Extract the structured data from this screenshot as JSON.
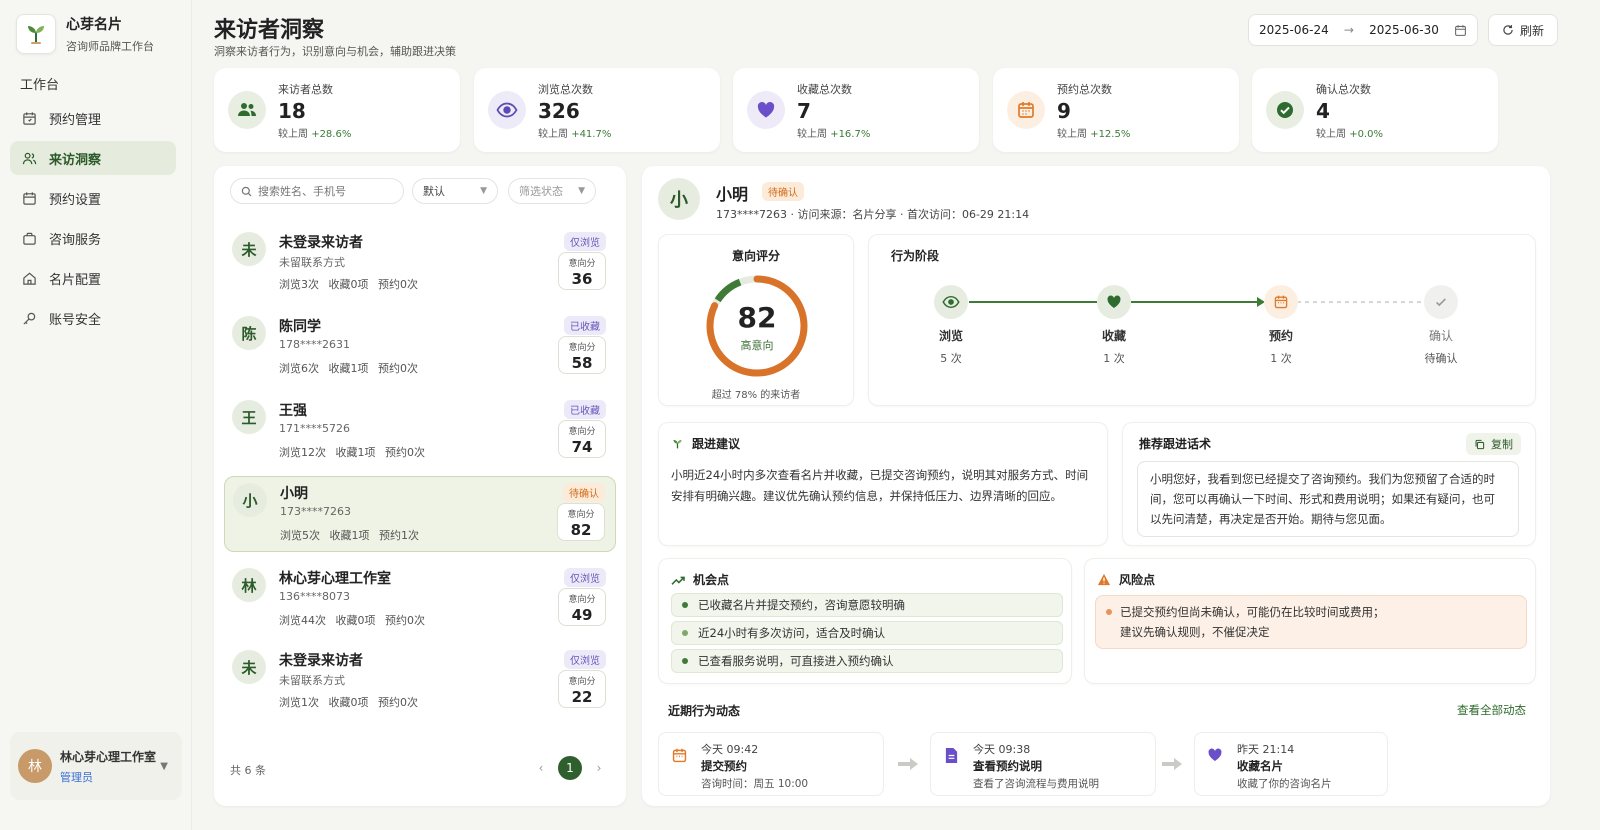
{
  "brand": {
    "name": "心芽名片",
    "subtitle": "咨询师品牌工作台"
  },
  "nav": {
    "section": "工作台",
    "items": [
      {
        "label": "预约管理",
        "icon": "calendar-icon"
      },
      {
        "label": "来访洞察",
        "icon": "users-icon",
        "active": true
      },
      {
        "label": "预约设置",
        "icon": "calendar-settings-icon"
      },
      {
        "label": "咨询服务",
        "icon": "briefcase-icon"
      },
      {
        "label": "名片配置",
        "icon": "home-icon"
      },
      {
        "label": "账号安全",
        "icon": "key-icon"
      }
    ]
  },
  "user": {
    "avatar": "林",
    "name": "林心芽心理工作室",
    "role": "管理员"
  },
  "header": {
    "title": "来访者洞察",
    "subtitle": "洞察来访者行为，识别意向与机会，辅助跟进决策"
  },
  "date_range": {
    "start": "2025-06-24",
    "sep": "→",
    "end": "2025-06-30"
  },
  "refresh_label": "刷新",
  "stats": [
    {
      "label": "来访者总数",
      "value": "18",
      "prefix": "较上周 ",
      "change": "+28.6%",
      "icon": "users-icon",
      "color": "#2f6b2e"
    },
    {
      "label": "浏览总次数",
      "value": "326",
      "prefix": "较上周 ",
      "change": "+41.7%",
      "icon": "eye-icon",
      "color": "#5b4bb5"
    },
    {
      "label": "收藏总次数",
      "value": "7",
      "prefix": "较上周 ",
      "change": "+16.7%",
      "icon": "heart-icon",
      "color": "#6b4fc8"
    },
    {
      "label": "预约总次数",
      "value": "9",
      "prefix": "较上周 ",
      "change": "+12.5%",
      "icon": "calendar-icon",
      "color": "#e07a2a"
    },
    {
      "label": "确认总次数",
      "value": "4",
      "prefix": "较上周 ",
      "change": "+0.0%",
      "icon": "check-circle-icon",
      "color": "#2f6b2e"
    }
  ],
  "filters": {
    "search_placeholder": "搜索姓名、手机号",
    "sort": "默认",
    "status_placeholder": "筛选状态"
  },
  "visitors": [
    {
      "avatar": "未",
      "name": "未登录来访者",
      "phone": "未留联系方式",
      "stats": "浏览3次 收藏0项 预约0次",
      "tag": "仅浏览",
      "tag_type": "blue",
      "score_label": "意向分",
      "score": "36"
    },
    {
      "avatar": "陈",
      "name": "陈同学",
      "phone": "178****2631",
      "stats": "浏览6次 收藏1项 预约0次",
      "tag": "已收藏",
      "tag_type": "blue",
      "score_label": "意向分",
      "score": "58"
    },
    {
      "avatar": "王",
      "name": "王强",
      "phone": "171****5726",
      "stats": "浏览12次 收藏1项 预约0次",
      "tag": "已收藏",
      "tag_type": "blue",
      "score_label": "意向分",
      "score": "74"
    },
    {
      "avatar": "小",
      "name": "小明",
      "phone": "173****7263",
      "stats": "浏览5次 收藏1项 预约1次",
      "tag": "待确认",
      "tag_type": "orange",
      "score_label": "意向分",
      "score": "82",
      "selected": true
    },
    {
      "avatar": "林",
      "name": "林心芽心理工作室",
      "phone": "136****8073",
      "stats": "浏览44次 收藏0项 预约0次",
      "tag": "仅浏览",
      "tag_type": "blue",
      "score_label": "意向分",
      "score": "49"
    },
    {
      "avatar": "未",
      "name": "未登录来访者",
      "phone": "未留联系方式",
      "stats": "浏览1次 收藏0项 预约0次",
      "tag": "仅浏览",
      "tag_type": "blue",
      "score_label": "意向分",
      "score": "22"
    }
  ],
  "list_footer": {
    "count": "共 6 条",
    "page": "1"
  },
  "detail": {
    "avatar": "小",
    "name": "小明",
    "tag": "待确认",
    "info": "173****7263 · 访问来源：名片分享 · 首次访问：06-29 21:14",
    "score": {
      "title": "意向评分",
      "value": 82,
      "level": "高意向",
      "footnote": "超过 78% 的来访者",
      "color": "#d9732a",
      "track": "#3f7a36"
    },
    "stage_title": "行为阶段",
    "stages": [
      {
        "name": "浏览",
        "count": "5 次",
        "icon": "eye-icon"
      },
      {
        "name": "收藏",
        "count": "1 次",
        "icon": "heart-icon"
      },
      {
        "name": "预约",
        "count": "1 次",
        "icon": "calendar-icon"
      },
      {
        "name": "确认",
        "count": "待确认",
        "icon": "check-icon"
      }
    ],
    "suggestion": {
      "title": "跟进建议",
      "text": "小明近24小时内多次查看名片并收藏，已提交咨询预约，说明其对服务方式、时间安排有明确兴趣。建议优先确认预约信息，并保持低压力、边界清晰的回应。"
    },
    "script": {
      "title": "推荐跟进话术",
      "copy": "复制",
      "text": "小明您好，我看到您已经提交了咨询预约。我们为您预留了合适的时间，您可以再确认一下时间、形式和费用说明；如果还有疑问，也可以先问清楚，再决定是否开始。期待与您见面。"
    },
    "opportunities": {
      "title": "机会点",
      "items": [
        "已收藏名片并提交预约，咨询意愿较明确",
        "近24小时有多次访问，适合及时确认",
        "已查看服务说明，可直接进入预约确认"
      ]
    },
    "risks": {
      "title": "风险点",
      "line1": "已提交预约但尚未确认，可能仍在比较时间或费用；",
      "line2": "建议先确认规则，不催促决定"
    },
    "activity": {
      "title": "近期行为动态",
      "view_all": "查看全部动态",
      "items": [
        {
          "time": "今天 09:42",
          "name": "提交预约",
          "desc": "咨询时间：周五 10:00",
          "icon": "calendar-icon"
        },
        {
          "time": "今天 09:38",
          "name": "查看预约说明",
          "desc": "查看了咨询流程与费用说明",
          "icon": "document-icon"
        },
        {
          "time": "昨天 21:14",
          "name": "收藏名片",
          "desc": "收藏了你的咨询名片",
          "icon": "heart-icon"
        }
      ]
    }
  }
}
